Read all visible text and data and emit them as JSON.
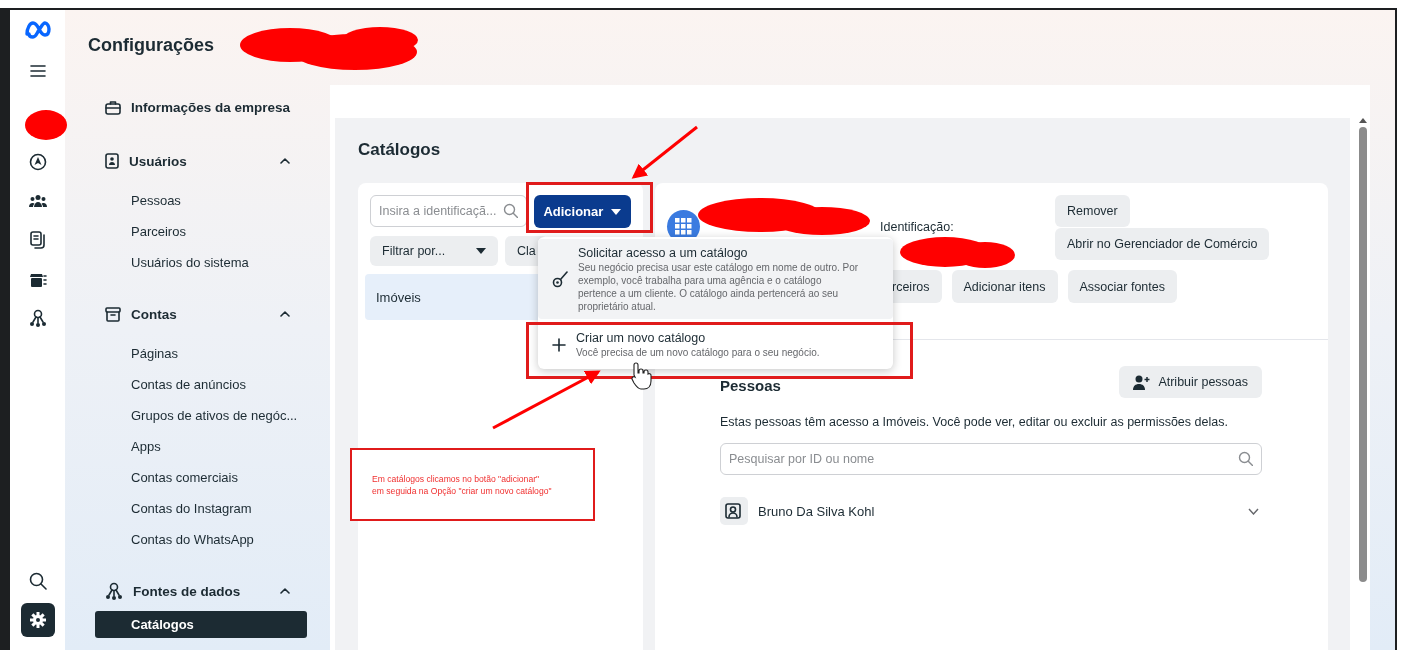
{
  "rail": {
    "top": [
      {
        "kind": "menu",
        "selected": false
      },
      {
        "kind": "compass",
        "selected": false
      },
      {
        "kind": "people",
        "selected": false
      },
      {
        "kind": "pages",
        "selected": false
      },
      {
        "kind": "shop",
        "selected": false
      },
      {
        "kind": "sources",
        "selected": false
      }
    ],
    "bottom": [
      {
        "kind": "search",
        "selected": false
      },
      {
        "kind": "settings",
        "selected": true
      }
    ]
  },
  "nav": {
    "title": "Configurações",
    "sections": [
      {
        "label": "Informações da empresa",
        "kind": "briefcase"
      },
      {
        "label": "Usuários",
        "kind": "badge",
        "expanded": true,
        "children": [
          {
            "label": "Pessoas",
            "selected": false
          },
          {
            "label": "Parceiros",
            "selected": false
          },
          {
            "label": "Usuários do sistema",
            "selected": false
          }
        ]
      },
      {
        "label": "Contas",
        "kind": "archive",
        "expanded": true,
        "children": [
          {
            "label": "Páginas",
            "selected": false
          },
          {
            "label": "Contas de anúncios",
            "selected": false
          },
          {
            "label": "Grupos de ativos de negóc...",
            "selected": false
          },
          {
            "label": "Apps",
            "selected": false
          },
          {
            "label": "Contas comerciais",
            "selected": false
          },
          {
            "label": "Contas do Instagram",
            "selected": false
          },
          {
            "label": "Contas do WhatsApp",
            "selected": false
          }
        ]
      },
      {
        "label": "Fontes de dados",
        "kind": "nodes",
        "expanded": true,
        "children": [
          {
            "label": "Catálogos",
            "selected": true
          }
        ]
      }
    ]
  },
  "page": {
    "title": "Catálogos",
    "search": {
      "placeholder": "Insira a identificaçã..."
    },
    "add_button": "Adicionar",
    "filter": "Filtrar por...",
    "sort_button": "Cla",
    "catalogs": [
      {
        "label": "Imóveis",
        "selected": true
      }
    ],
    "detail": {
      "id_label": "Identificação:",
      "actions": [
        "Remover",
        "Abrir no Gerenciador de Comércio"
      ],
      "buttons": [
        "rceiros",
        "Adicionar itens",
        "Associar fontes"
      ]
    },
    "people": {
      "title": "Pessoas",
      "assign_button": "Atribuir pessoas",
      "description": "Estas pessoas têm acesso a Imóveis. Você pode ver, editar ou excluir as permissões delas.",
      "search": {
        "placeholder": "Pesquisar por ID ou nome"
      },
      "rows": [
        {
          "name": "Bruno Da Silva Kohl",
          "expanded": false
        }
      ]
    }
  },
  "menu": {
    "items": [
      {
        "kind": "key",
        "title": "Solicitar acesso a um catálogo",
        "description": "Seu negócio precisa usar este catálogo em nome de outro. Por exemplo, você trabalha para uma agência e o catálogo pertence a um cliente. O catálogo ainda pertencerá ao seu proprietário atual.",
        "highlighted": true
      },
      {
        "kind": "plus",
        "title": "Criar um novo catálogo",
        "description": "Você precisa de um novo catálogo para o seu negócio.",
        "highlighted": false
      }
    ]
  },
  "annotation": {
    "note_lines": [
      "Em catálogos clicamos no botão \"adicionar\"",
      "em seguida na Opção \"criar um novo catálogo\""
    ]
  }
}
